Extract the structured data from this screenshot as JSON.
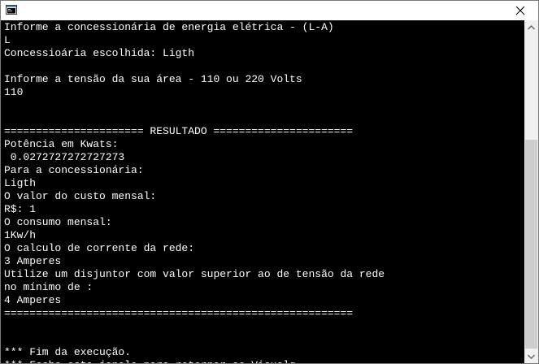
{
  "window": {
    "title": "",
    "app_icon": "terminal-window-icon",
    "close_icon": "close-icon"
  },
  "console": {
    "lines": [
      "Informe a concessionária de energia elétrica - (L-A)",
      "L",
      "Concessioária escolhida: Ligth",
      "",
      "Informe a tensão da sua área - 110 ou 220 Volts",
      "110",
      "",
      "",
      "====================== RESULTADO ======================",
      "Potência em Kwats:",
      " 0.0272727272727273",
      "Para a concessionária:",
      "Ligth",
      "O valor do custo mensal:",
      "R$: 1",
      "O consumo mensal:",
      "1Kw/h",
      "O calculo de corrente da rede:",
      "3 Amperes",
      "Utilize um disjuntor com valor superior ao de tensão da rede",
      "no mínimo de :",
      "4 Amperes",
      "=======================================================",
      "",
      "",
      "*** Fim da execução.",
      "*** Feche esta janela para retornar ao Visualg."
    ]
  },
  "scrollbar": {
    "up_icon": "scroll-up-arrow-icon",
    "down_icon": "scroll-down-arrow-icon"
  },
  "colors": {
    "console_bg": "#000000",
    "console_text": "#ffffff",
    "scrollbar_track": "#f0f0f0",
    "scrollbar_thumb": "#cdcdcd"
  }
}
